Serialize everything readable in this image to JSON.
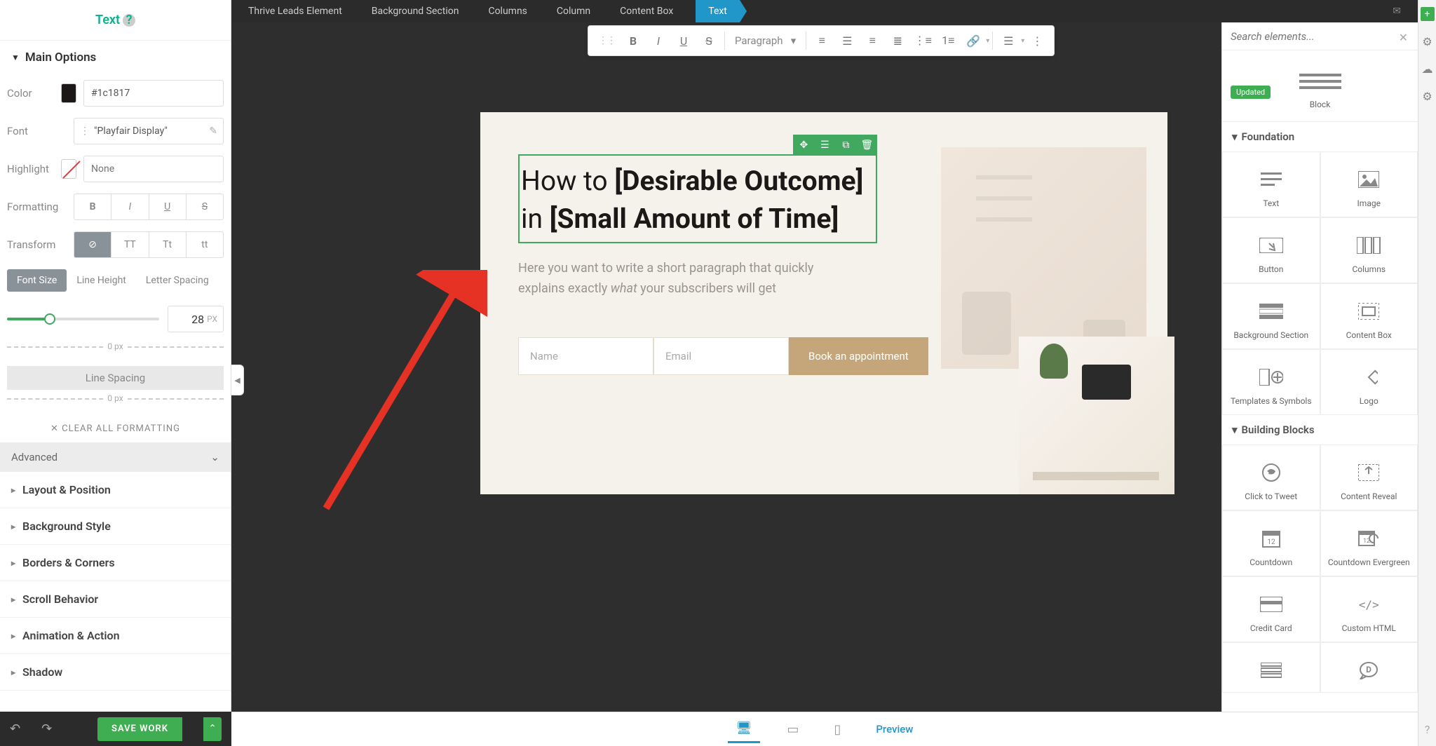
{
  "leftPanel": {
    "title": "Text",
    "mainOptions": "Main Options",
    "labels": {
      "color": "Color",
      "font": "Font",
      "highlight": "Highlight",
      "formatting": "Formatting",
      "transform": "Transform"
    },
    "colorValue": "#1c1817",
    "fontValue": "\"Playfair Display\"",
    "highlightPlaceholder": "None",
    "formatButtons": [
      "B",
      "I",
      "U",
      "S"
    ],
    "transformButtons": [
      "⊘",
      "TT",
      "Tt",
      "tt"
    ],
    "tabs": [
      "Font Size",
      "Line Height",
      "Letter Spacing"
    ],
    "fontSize": "28",
    "fontSizeUnit": "PX",
    "lineSpacing": "Line Spacing",
    "zeroPx": "0 px",
    "clearFormatting": "CLEAR ALL FORMATTING",
    "advanced": "Advanced",
    "accordions": [
      "Layout & Position",
      "Background Style",
      "Borders & Corners",
      "Scroll Behavior",
      "Animation & Action",
      "Shadow"
    ],
    "saveWork": "SAVE WORK"
  },
  "breadcrumb": [
    "Thrive Leads Element",
    "Background Section",
    "Columns",
    "Column",
    "Content Box",
    "Text"
  ],
  "toolbar": {
    "paragraph": "Paragraph"
  },
  "canvas": {
    "headingPlain1": "How to ",
    "headingBold1": "[Desirable Outcome]",
    "headingPlain2": "in ",
    "headingBold2": "[Small Amount of Time]",
    "desc1": "Here you want to write a short paragraph that quickly explains exactly ",
    "descItalic": "what",
    "desc2": " your subscribers will get",
    "namePlaceholder": "Name",
    "emailPlaceholder": "Email",
    "cta": "Book an appointment"
  },
  "rightPanel": {
    "searchPlaceholder": "Search elements...",
    "updated": "Updated",
    "block": "Block",
    "foundation": "Foundation",
    "buildingBlocks": "Building Blocks",
    "elements": {
      "text": "Text",
      "image": "Image",
      "button": "Button",
      "columns": "Columns",
      "bgSection": "Background Section",
      "contentBox": "Content Box",
      "templates": "Templates & Symbols",
      "logo": "Logo",
      "clickTweet": "Click to Tweet",
      "contentReveal": "Content Reveal",
      "countdown": "Countdown",
      "countdownEvergreen": "Countdown Evergreen",
      "creditCard": "Credit Card",
      "customHtml": "Custom HTML"
    }
  },
  "footer": {
    "preview": "Preview"
  }
}
